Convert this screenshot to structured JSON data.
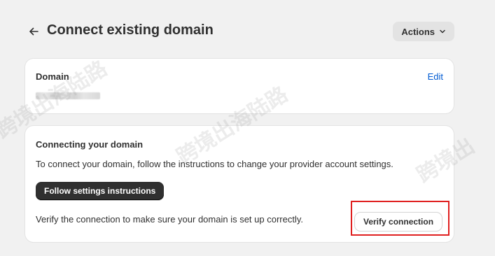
{
  "header": {
    "title": "Connect existing domain",
    "actions_label": "Actions",
    "back_icon": "arrow-left-icon",
    "actions_icon": "chevron-down-icon"
  },
  "domain_card": {
    "heading": "Domain",
    "edit_label": "Edit"
  },
  "connect_card": {
    "heading": "Connecting your domain",
    "description": "To connect your domain, follow the instructions to change your provider account settings.",
    "follow_button": "Follow settings instructions",
    "verify_text": "Verify the connection to make sure your domain is set up correctly.",
    "verify_button": "Verify connection"
  },
  "watermarks": [
    "跨境出海陆路",
    "跨境出海陆路",
    "跨境出"
  ],
  "colors": {
    "background": "#f1f1f1",
    "link": "#005bd3",
    "primary_button": "#303030",
    "highlight": "#e02020"
  }
}
